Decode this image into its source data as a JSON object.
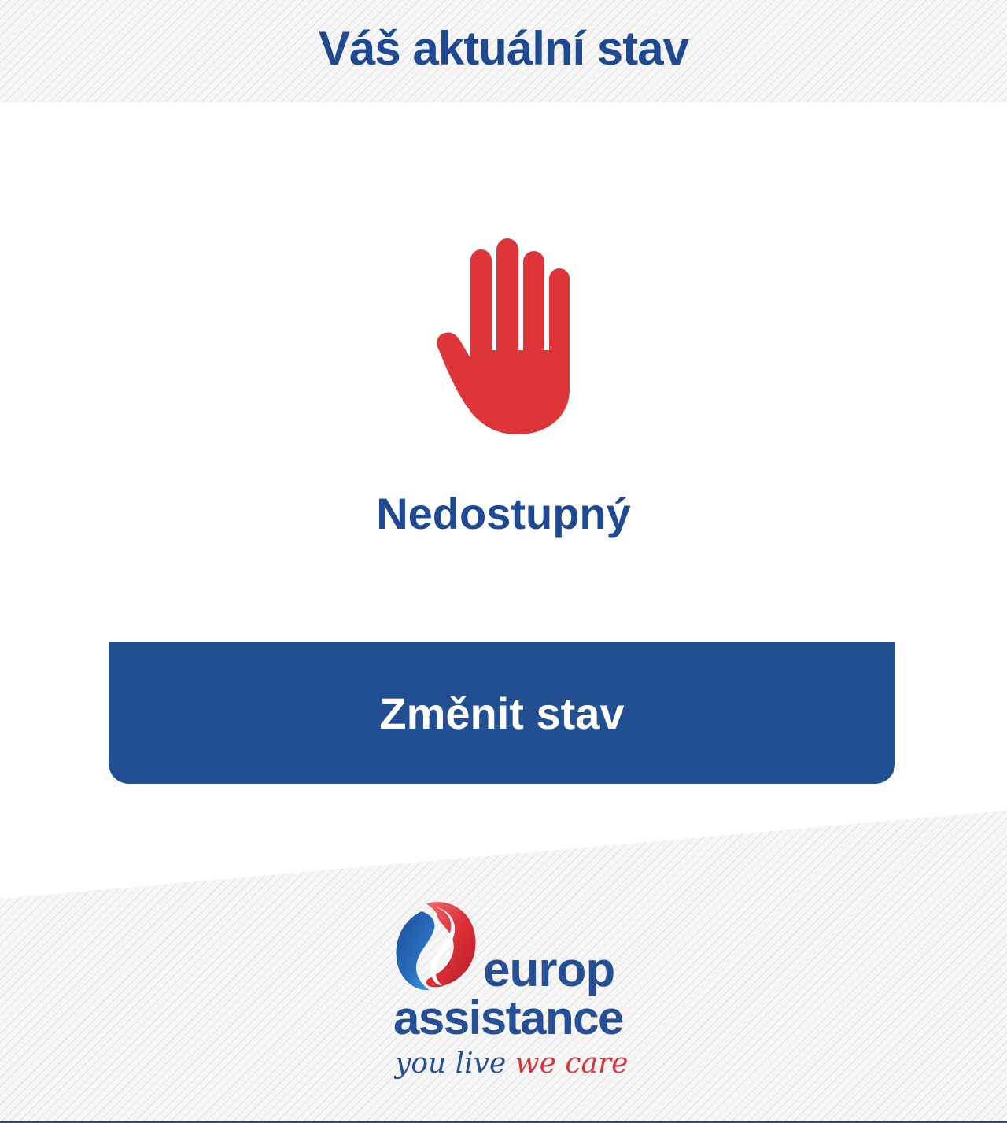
{
  "header": {
    "title": "Váš aktuální stav"
  },
  "status": {
    "icon": "stop-hand-icon",
    "label": "Nedostupný",
    "color": "#de3539"
  },
  "actions": {
    "change_status_label": "Změnit stav"
  },
  "brand": {
    "name_line1": "europ",
    "name_line2": "assistance",
    "tagline_part1": "you live",
    "tagline_part2": "we care",
    "primary_color": "#224e92",
    "accent_color": "#d8343b"
  }
}
